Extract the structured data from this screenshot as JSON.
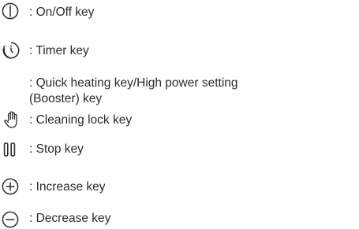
{
  "legend": {
    "items": [
      {
        "icon": "power-icon",
        "text": ": On/Off key"
      },
      {
        "icon": "timer-icon",
        "text": ": Timer key"
      },
      {
        "icon": "booster-icon",
        "text": ": Quick heating key/High power setting (Booster) key"
      },
      {
        "icon": "hand-lock-icon",
        "text": ": Cleaning lock key"
      },
      {
        "icon": "pause-icon",
        "text": ": Stop key"
      },
      {
        "icon": "plus-circle-icon",
        "text": ": Increase key"
      },
      {
        "icon": "minus-circle-icon",
        "text": ": Decrease key"
      }
    ]
  }
}
